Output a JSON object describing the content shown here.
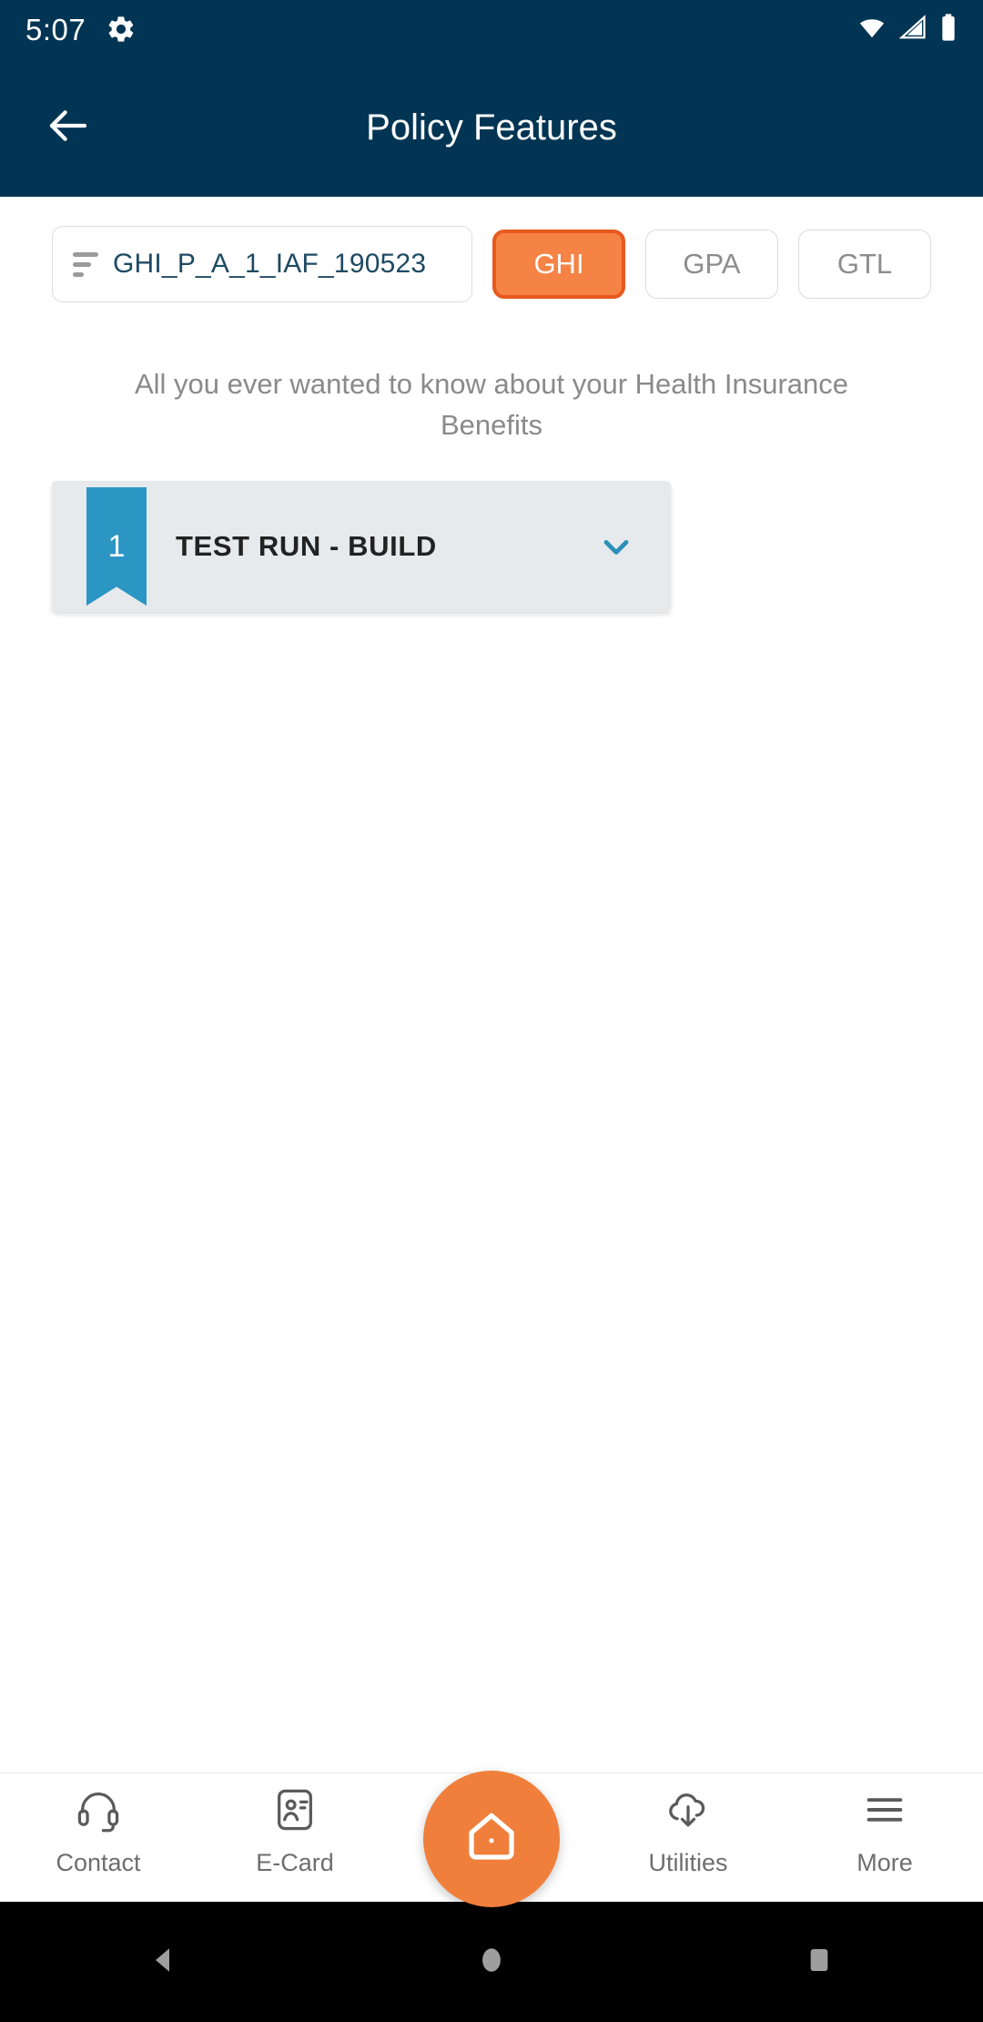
{
  "statusbar": {
    "time": "5:07",
    "gear_icon": "gear-icon",
    "wifi_icon": "wifi-icon",
    "signal_icon": "signal-icon",
    "battery_icon": "battery-icon"
  },
  "appbar": {
    "back_icon": "back-arrow-icon",
    "title": "Policy Features"
  },
  "filters": {
    "policy_field": {
      "icon": "filter-lines-icon",
      "value": "GHI_P_A_1_IAF_190523"
    },
    "chips": [
      {
        "label": "GHI",
        "active": true
      },
      {
        "label": "GPA",
        "active": false
      },
      {
        "label": "GTL",
        "active": false
      }
    ]
  },
  "subtitle": "All you ever wanted to know about your Health Insurance Benefits",
  "accordion": {
    "badge_number": "1",
    "title": "TEST RUN - BUILD",
    "chevron_icon": "chevron-down-icon"
  },
  "bottomnav": {
    "items": [
      {
        "label": "Contact",
        "icon": "headset-icon"
      },
      {
        "label": "E-Card",
        "icon": "id-card-icon"
      },
      {
        "label": "Utilities",
        "icon": "cloud-download-icon"
      },
      {
        "label": "More",
        "icon": "hamburger-menu-icon"
      }
    ],
    "fab_icon": "home-icon"
  },
  "androidnav": {
    "back_icon": "android-back-icon",
    "home_icon": "android-home-icon",
    "recents_icon": "android-recents-icon"
  },
  "colors": {
    "header_navy": "#023453",
    "accent_orange": "#f07f3c",
    "chip_orange_fill": "#f58345",
    "chip_orange_border": "#e8591f",
    "ribbon_blue": "#2b96c4",
    "card_gray": "#e6eaec"
  }
}
